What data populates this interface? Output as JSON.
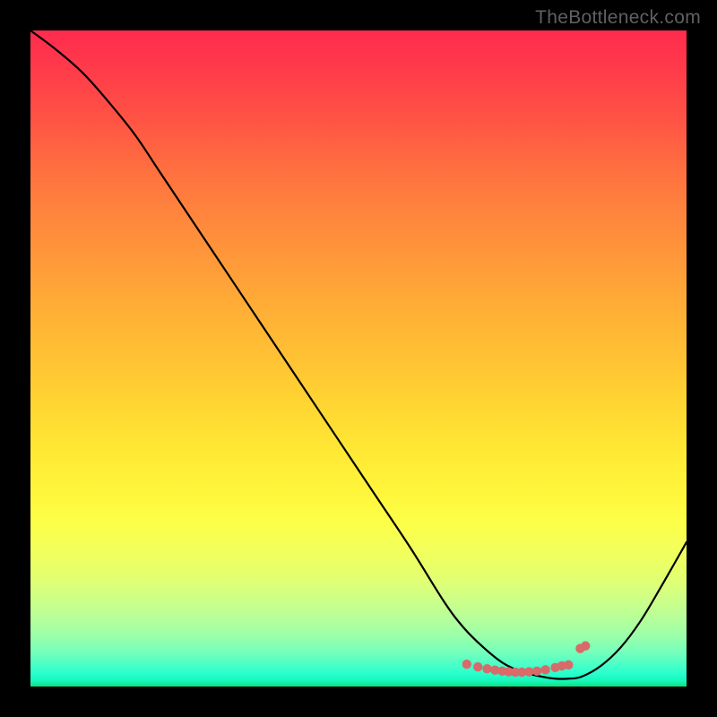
{
  "watermark": "TheBottleneck.com",
  "chart_data": {
    "type": "line",
    "title": "",
    "xlabel": "",
    "ylabel": "",
    "ylim": [
      0,
      100
    ],
    "xlim": [
      0,
      100
    ],
    "series": [
      {
        "name": "curve",
        "x": [
          0,
          4,
          8,
          12,
          16,
          20,
          28,
          36,
          44,
          52,
          58,
          63,
          66,
          69,
          72,
          75,
          78,
          80,
          82,
          84,
          87,
          90,
          93,
          96,
          100
        ],
        "y": [
          100,
          97,
          93.5,
          89,
          84,
          78,
          66,
          54,
          42,
          30,
          21,
          13,
          9,
          6,
          3.6,
          2.2,
          1.5,
          1.2,
          1.2,
          1.5,
          3.2,
          6,
          10,
          15,
          22
        ]
      }
    ],
    "markers": {
      "name": "dots",
      "x": [
        66.5,
        68.2,
        69.6,
        70.8,
        71.9,
        72.9,
        73.9,
        74.9,
        76.0,
        77.2,
        78.5,
        80.0,
        81.0,
        82.0,
        83.8,
        84.6
      ],
      "y": [
        3.4,
        3.0,
        2.7,
        2.5,
        2.35,
        2.25,
        2.2,
        2.2,
        2.25,
        2.35,
        2.55,
        2.9,
        3.15,
        3.3,
        5.8,
        6.2
      ]
    },
    "gradient_stops": [
      {
        "pos": 0,
        "color": "#ff2b4e"
      },
      {
        "pos": 50,
        "color": "#ffc233"
      },
      {
        "pos": 75,
        "color": "#fcff48"
      },
      {
        "pos": 100,
        "color": "#0ce07e"
      }
    ]
  }
}
